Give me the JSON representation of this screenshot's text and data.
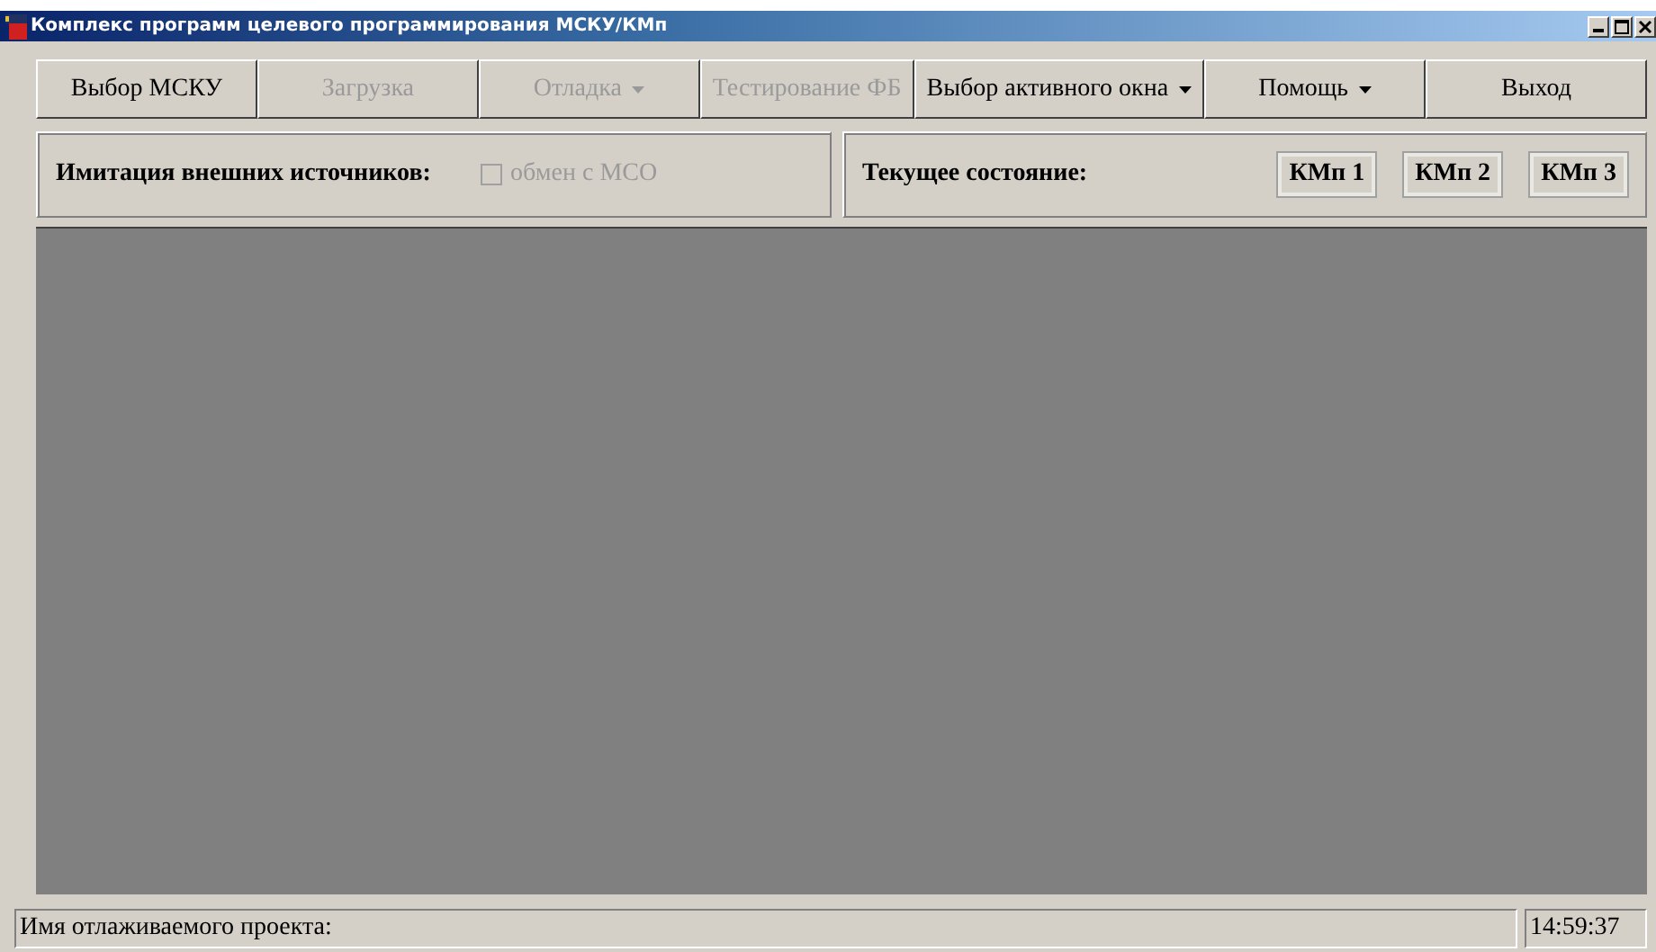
{
  "window": {
    "title": "Комплекс программ целевого программирования МСКУ/КМп"
  },
  "toolbar": [
    {
      "label": "Выбор МСКУ",
      "disabled": false,
      "dropdown": false
    },
    {
      "label": "Загрузка",
      "disabled": true,
      "dropdown": false
    },
    {
      "label": "Отладка",
      "disabled": true,
      "dropdown": true
    },
    {
      "label": "Тестирование ФБ",
      "disabled": true,
      "dropdown": false
    },
    {
      "label": "Выбор активного окна",
      "disabled": false,
      "dropdown": true
    },
    {
      "label": "Помощь",
      "disabled": false,
      "dropdown": true
    },
    {
      "label": "Выход",
      "disabled": false,
      "dropdown": false
    }
  ],
  "imitation_panel": {
    "label": "Имитация внешних источников:",
    "checkbox": {
      "label": "обмен с МСО",
      "checked": false,
      "disabled": true
    }
  },
  "state_panel": {
    "label": "Текущее состояние:",
    "indicators": [
      "КМп 1",
      "КМп 2",
      "КМп 3"
    ]
  },
  "status_bar": {
    "project_label": "Имя отлаживаемого проекта:",
    "time": "14:59:37"
  }
}
